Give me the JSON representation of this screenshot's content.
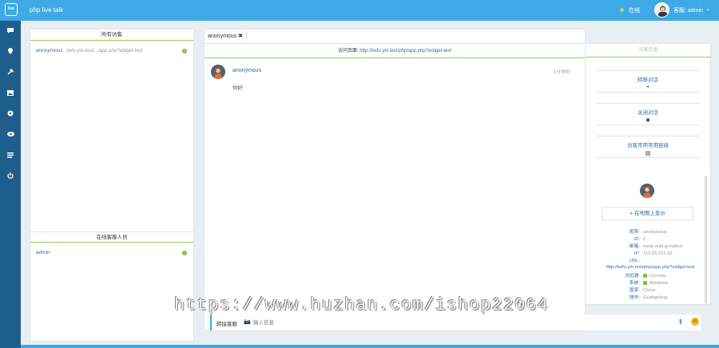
{
  "topbar": {
    "logo_text": "live",
    "app_title": "php live talk",
    "status": "在线",
    "user_name": "客服: admin",
    "accent": "#3fa9e6"
  },
  "nav": {
    "icons": [
      "chat-icon",
      "location-icon",
      "wrench-icon",
      "image-icon",
      "settings-icon",
      "eye-icon",
      "list-icon",
      "power-icon"
    ]
  },
  "visitors": {
    "title": "所有访客",
    "items": [
      {
        "name": "anonymous",
        "url": "kefu.ym.test/.../app.php?widget-test"
      }
    ]
  },
  "agents": {
    "title": "在线客服人员",
    "items": [
      {
        "name": "admin"
      }
    ]
  },
  "chat": {
    "tab_label": "anonymous",
    "url_label": "访问页面:",
    "url": "http://kefu.ym.test/php/app.php?widget-test",
    "messages": [
      {
        "sender": "anonymous",
        "time": "1分钟前",
        "text": "你好"
      }
    ]
  },
  "input": {
    "label": "转接客服",
    "placeholder": "输入信息"
  },
  "sidepanel": {
    "title": "访客信息",
    "actions": [
      {
        "label": "转移对话",
        "icon": "+"
      },
      {
        "label": "关闭对话",
        "icon": "✖"
      },
      {
        "label": "访客常用常用链接",
        "icon": "▤"
      }
    ],
    "map_button": "在地图上显示",
    "info": {
      "name_label": "昵称:",
      "name": "anonymous",
      "id_label": "ID:",
      "id": "2",
      "email_label": "邮箱:",
      "email": "none.mail.provided",
      "ip_label": "IP:",
      "ip": "113.65.231.02",
      "url_label": "URL:",
      "url": "http://kefu.ym.test/php/app.php?widget-test",
      "browser_label": "浏览器:",
      "browser": "Chrome",
      "os_label": "系统:",
      "os": "Windows",
      "country_label": "国家:",
      "country": "China",
      "city_label": "城市:",
      "city": "Guangdong"
    }
  },
  "watermark": "https://www.huzhan.com/ishop22064"
}
